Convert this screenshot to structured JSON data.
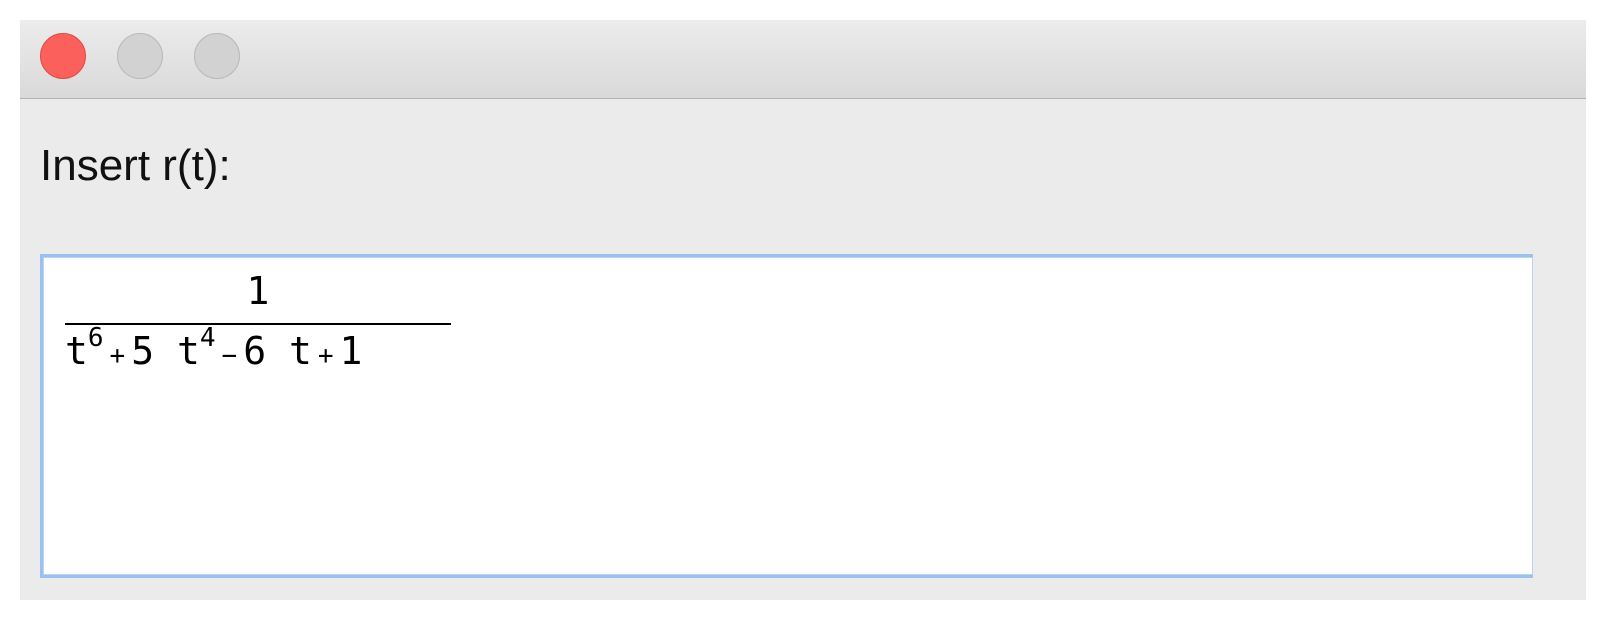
{
  "window": {
    "traffic_lights": [
      "close",
      "minimize",
      "zoom"
    ],
    "colors": {
      "close": "#fc605c",
      "inactive": "#d2d2d2",
      "focus_ring": "#9cc1ee"
    }
  },
  "prompt": {
    "label": "Insert r(t):"
  },
  "expression": {
    "numerator": "1",
    "denominator": {
      "term1_base": "t",
      "term1_exp": "6",
      "op1": "+",
      "term2_coef": "5",
      "term2_base": "t",
      "term2_exp": "4",
      "op2": "−",
      "term3_coef": "6",
      "term3_base": "t",
      "op3": "+",
      "term4": "1"
    }
  }
}
